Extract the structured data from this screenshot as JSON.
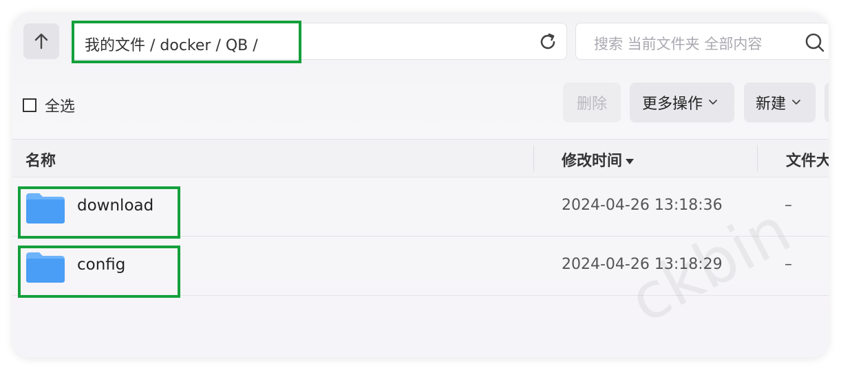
{
  "toolbar": {
    "path": "我的文件 / docker / QB /",
    "search_placeholder": "搜索 当前文件夹 全部内容",
    "select_all": "全选",
    "delete": "删除",
    "more_actions": "更多操作",
    "new": "新建"
  },
  "table": {
    "columns": [
      "名称",
      "修改时间",
      "文件大"
    ],
    "sort_column": "修改时间",
    "rows": [
      {
        "name": "download",
        "modified": "2024-04-26 13:18:36",
        "size": "–"
      },
      {
        "name": "config",
        "modified": "2024-04-26 13:18:29",
        "size": "–"
      }
    ]
  },
  "icons": {
    "up": "arrow-up-icon",
    "refresh": "refresh-icon",
    "search": "search-icon",
    "folder": "folder-icon",
    "chevron": "chevron-down-icon"
  },
  "colors": {
    "highlight": "#14a03c",
    "folder": "#4a9ef5"
  },
  "watermark": "ckbin"
}
